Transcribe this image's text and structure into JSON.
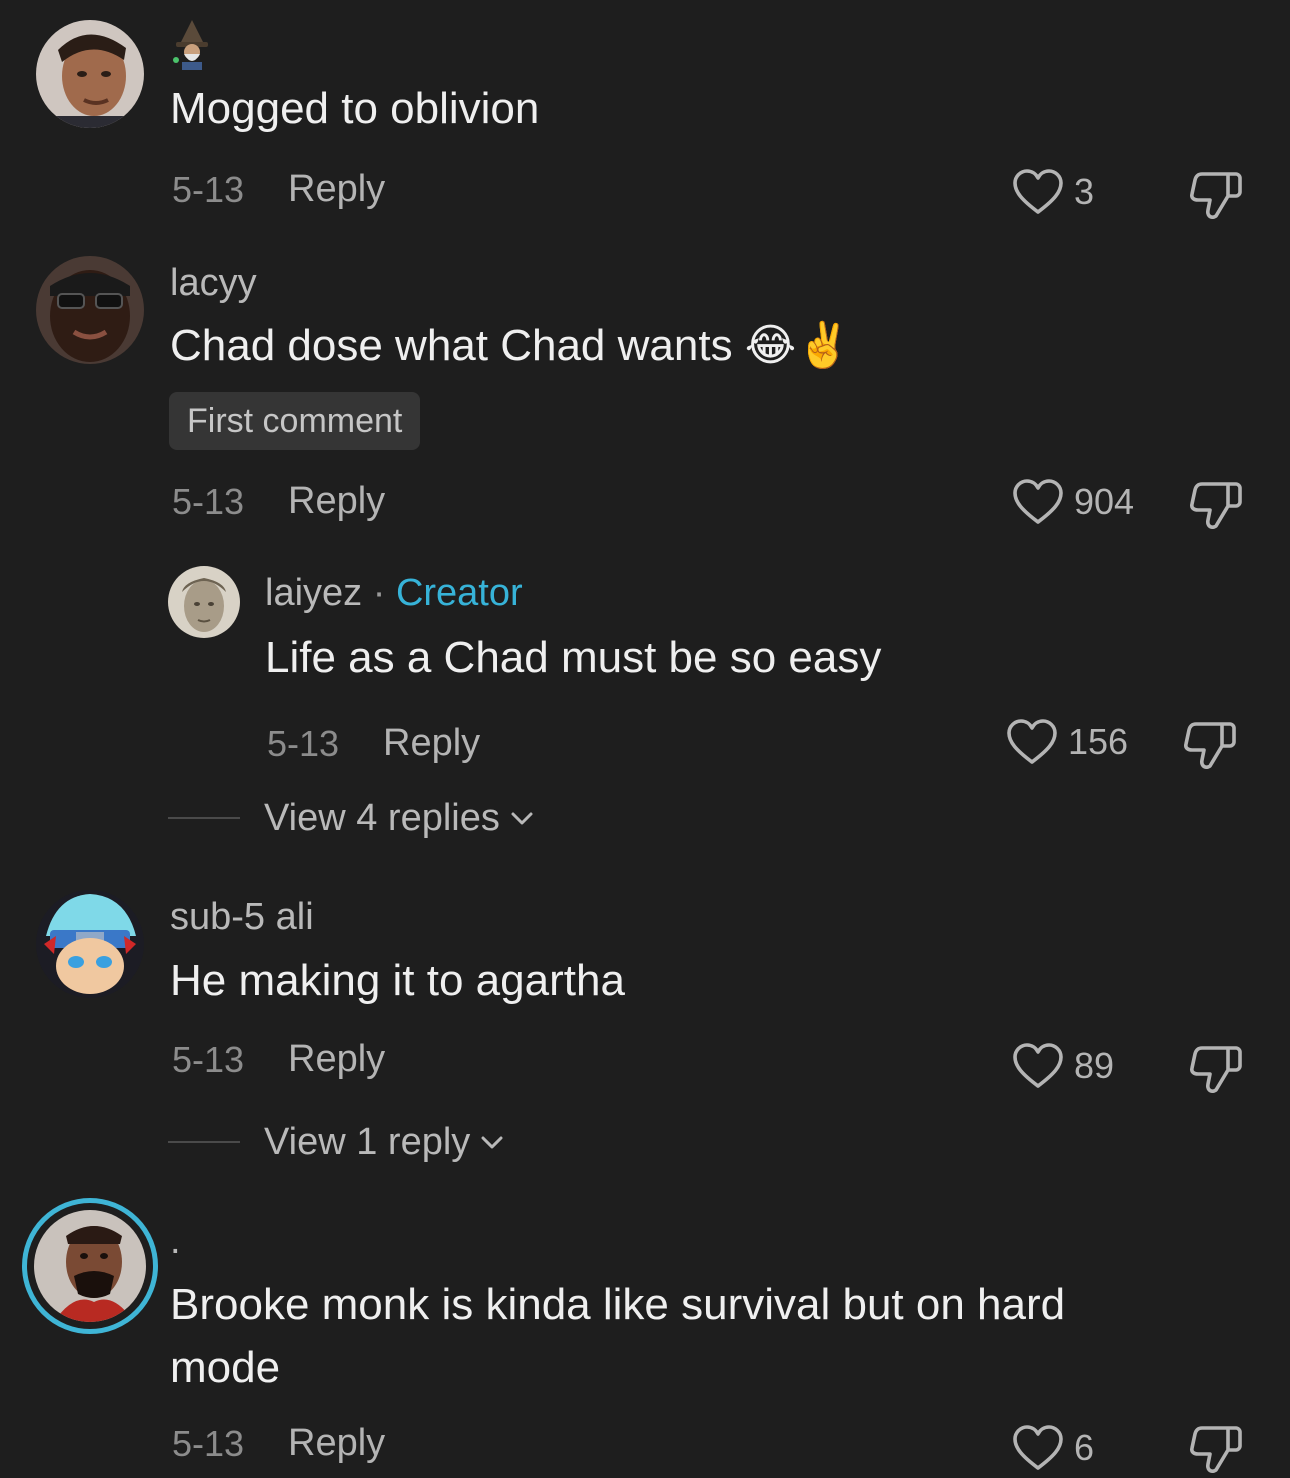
{
  "colors": {
    "background": "#1e1e1e",
    "creator_accent": "#37b3d8",
    "avatar_ring": "#3fb5d6"
  },
  "comments": [
    {
      "username": "",
      "username_icon": "wizard-emoji-icon",
      "text": "Mogged to oblivion",
      "date": "5-13",
      "reply_label": "Reply",
      "likes": "3"
    },
    {
      "username": "lacyy",
      "text": "Chad dose what Chad wants 😂✌️",
      "badge": "First comment",
      "date": "5-13",
      "reply_label": "Reply",
      "likes": "904",
      "replies": [
        {
          "username": "laiyez",
          "separator": "·",
          "creator_label": "Creator",
          "text": "Life as a Chad must be so easy",
          "date": "5-13",
          "reply_label": "Reply",
          "likes": "156"
        }
      ],
      "view_replies": "View 4 replies"
    },
    {
      "username": "sub-5 ali",
      "text": "He making it to agartha",
      "date": "5-13",
      "reply_label": "Reply",
      "likes": "89",
      "view_replies": "View 1 reply"
    },
    {
      "username": ".",
      "text_line1": "Brooke monk is kinda like survival but on hard",
      "text_line2": "mode",
      "date": "5-13",
      "reply_label": "Reply",
      "likes": "6"
    }
  ]
}
